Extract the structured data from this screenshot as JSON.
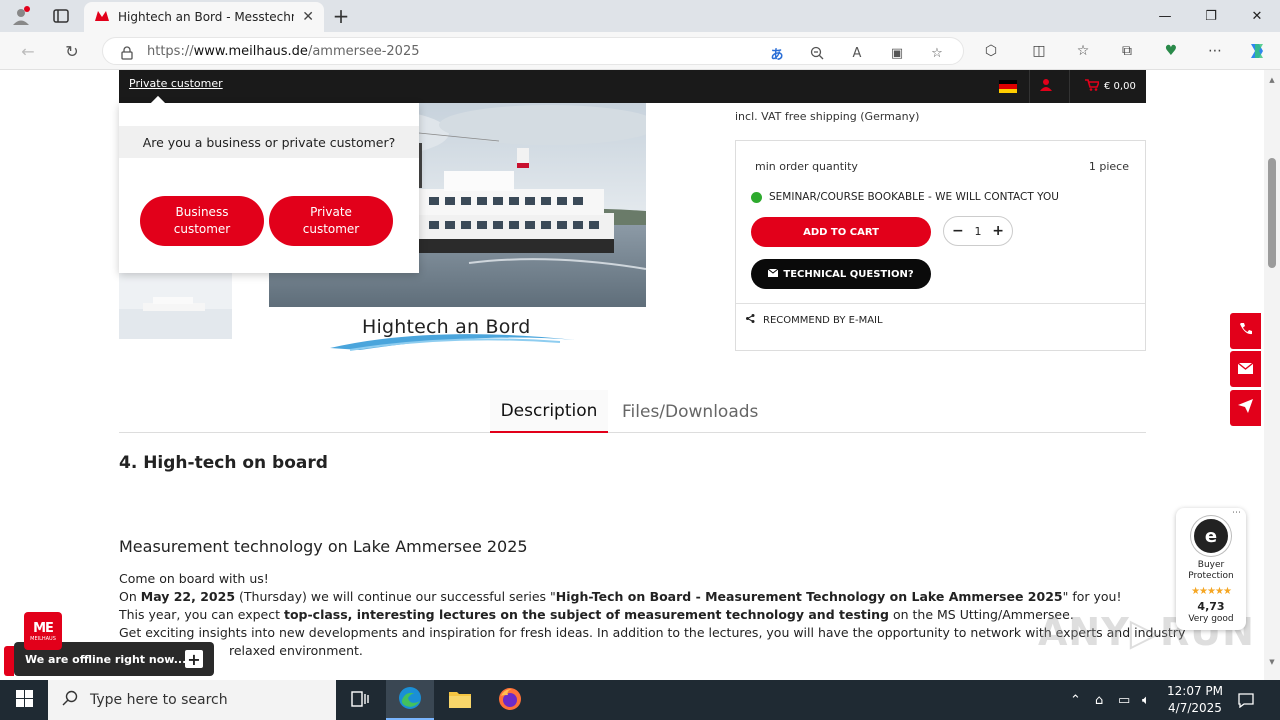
{
  "browser": {
    "tab_title": "Hightech an Bord - Messtechnik",
    "url_prefix": "https://",
    "url_domain": "www.meilhaus.de",
    "url_path": "/ammersee-2025"
  },
  "topbar": {
    "private_link": "Private customer",
    "cart_total": "€ 0,00"
  },
  "popup": {
    "question": "Are you a business or private customer?",
    "business_label": "Business customer",
    "private_label": "Private customer"
  },
  "product": {
    "logo_text": "Hightech an Bord",
    "price_note": "incl. VAT free shipping (Germany)",
    "min_order_label": "min order quantity",
    "min_order_value": "1 piece",
    "status_text": "SEMINAR/COURSE BOOKABLE - WE WILL CONTACT YOU",
    "add_to_cart": "ADD TO CART",
    "quantity": "1",
    "tech_question": "TECHNICAL QUESTION?",
    "recommend": "RECOMMEND BY E-MAIL"
  },
  "tabs": {
    "description": "Description",
    "files": "Files/Downloads"
  },
  "content": {
    "heading": "4. High-tech on board",
    "subheading": "Measurement technology on Lake Ammersee 2025",
    "line1": "Come on board with us!",
    "line2_a": "On ",
    "line2_b": "May 22, 2025",
    "line2_c": " (Thursday) we will continue our successful series \"",
    "line2_d": "High-Tech on Board - Measurement Technology on Lake Ammersee 2025",
    "line2_e": "\" for you!",
    "line3_a": "This year, you can expect ",
    "line3_b": "top-class, interesting lectures on the subject of measurement technology and testing",
    "line3_c": " on the MS Utting/Ammersee.",
    "line4": "Get exciting insights into new developments and inspiration for fresh ideas. In addition to the lectures, you will have the opportunity to network with experts and industry",
    "line5": "relaxed environment."
  },
  "trust_widget": {
    "label": "Buyer Protection",
    "rating": "4,73",
    "verdict": "Very good",
    "stars": "★★★★★"
  },
  "chat": {
    "badge_text": "MEILHAUS",
    "offline_text": "We are offline right now..."
  },
  "taskbar": {
    "search_placeholder": "Type here to search",
    "time": "12:07 PM",
    "date": "4/7/2025"
  },
  "colors": {
    "brand_red": "#e2001a",
    "topbar_black": "#1a1a1a",
    "status_green": "#2eaa2e"
  }
}
